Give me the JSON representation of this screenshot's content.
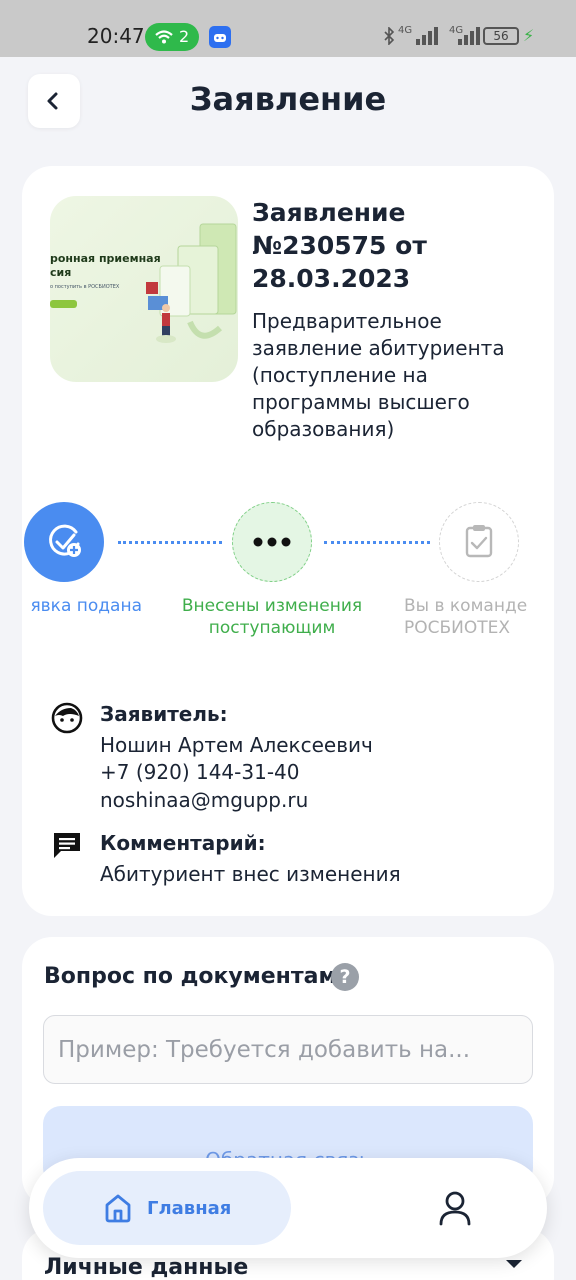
{
  "status_bar": {
    "time": "20:47",
    "hotspot_count": "2",
    "network_1": "4G",
    "network_2": "4G",
    "battery": "56"
  },
  "header": {
    "title": "Заявление"
  },
  "application": {
    "title": "Заявление №230575 от 28.03.2023",
    "subtitle": "Предварительное заявление абитуриента (поступление на программы высшего образования)",
    "image_text_line1": "ронная приемная",
    "image_text_line2": "сия",
    "image_text_line3": "о поступить в РОСБИОТЕХ"
  },
  "progress": {
    "steps": [
      {
        "label": "явка подана",
        "state": "done",
        "icon": "check-plus-icon"
      },
      {
        "label": "Внесены изменения поступающим",
        "state": "current",
        "icon": "dots-icon"
      },
      {
        "label": "Вы в команде РОСБИОТЕХ",
        "state": "pending",
        "icon": "clipboard-check-icon"
      }
    ]
  },
  "applicant": {
    "label": "Заявитель:",
    "name": "Ношин Артем Алексеевич",
    "phone": "+7 (920) 144-31-40",
    "email": "noshinaa@mgupp.ru"
  },
  "comment": {
    "label": "Комментарий:",
    "text": "Абитуриент внес изменения"
  },
  "question": {
    "title": "Вопрос по документам",
    "help": "?",
    "placeholder": "Пример: Требуется добавить на...",
    "value": "",
    "submit_label": "Обратная связь"
  },
  "personal_data": {
    "title": "Личные данные"
  },
  "nav": {
    "home_label": "Главная"
  },
  "colors": {
    "accent": "#4a8cf0",
    "success": "#3fae4b",
    "muted": "#b3b3b3",
    "background": "#f3f4f8"
  }
}
